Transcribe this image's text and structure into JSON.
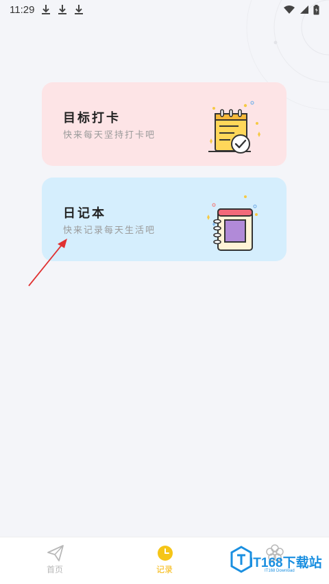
{
  "status_bar": {
    "time": "11:29",
    "download_icons": [
      "download-icon",
      "download-icon",
      "download-icon"
    ],
    "right_icons": [
      "wifi-icon",
      "signal-icon",
      "battery-icon"
    ]
  },
  "cards": [
    {
      "title": "目标打卡",
      "subtitle": "快来每天坚持打卡吧",
      "icon": "notepad-check-icon",
      "color": "#fde4e6"
    },
    {
      "title": "日记本",
      "subtitle": "快来记录每天生活吧",
      "icon": "diary-book-icon",
      "color": "#d5eefd"
    }
  ],
  "tabbar": {
    "tabs": [
      {
        "label": "首页",
        "icon": "paper-plane-icon",
        "active": false
      },
      {
        "label": "记录",
        "icon": "clock-icon",
        "active": true
      },
      {
        "label": "",
        "icon": "flower-icon",
        "active": false
      }
    ],
    "active_color": "#f5b400",
    "inactive_color": "#b8b8b8"
  },
  "watermark": {
    "text": "IT168下载站",
    "sub": "IT168 Download"
  },
  "annotation": {
    "icon": "red-arrow-icon",
    "color": "#e03131"
  }
}
